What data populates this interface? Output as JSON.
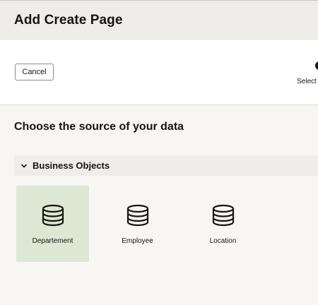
{
  "header": {
    "title": "Add Create Page"
  },
  "toolbar": {
    "cancel_label": "Cancel",
    "step_label": "Select"
  },
  "main": {
    "section_title": "Choose the source of your data",
    "group": {
      "label": "Business Objects",
      "expanded": true
    },
    "tiles": [
      {
        "label": "Departement",
        "icon": "database-icon",
        "selected": true
      },
      {
        "label": "Employee",
        "icon": "database-icon",
        "selected": false
      },
      {
        "label": "Location",
        "icon": "database-icon",
        "selected": false
      }
    ]
  },
  "colors": {
    "header_bg": "#efedea",
    "page_bg": "#f8f6f3",
    "selected_tile_bg": "#dce8d3",
    "text": "#161513"
  }
}
